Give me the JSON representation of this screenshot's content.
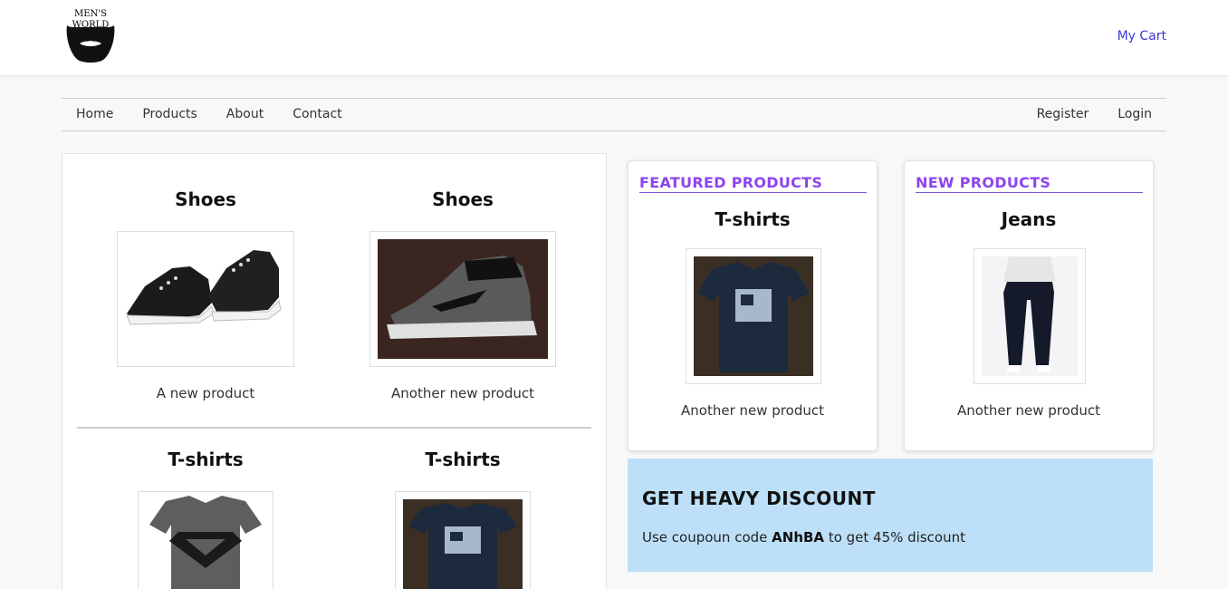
{
  "brand": {
    "logo_line1": "MEN'S",
    "logo_line2": "WORLD",
    "logo_icon": "beard-icon"
  },
  "header": {
    "cart_label": "My Cart",
    "link_color": "#3a3ad6"
  },
  "nav": {
    "left": [
      "Home",
      "Products",
      "About",
      "Contact"
    ],
    "right": [
      "Register",
      "Login"
    ]
  },
  "products": [
    {
      "title": "Shoes",
      "description": "A new product",
      "image": "sneakers-image"
    },
    {
      "title": "Shoes",
      "description": "Another new product",
      "image": "high-top-shoe-image"
    },
    {
      "title": "T-shirts",
      "description": "",
      "image": "superman-batman-tshirt-image"
    },
    {
      "title": "T-shirts",
      "description": "",
      "image": "navy-graphic-tshirt-image"
    }
  ],
  "featured": {
    "heading": "FEATURED PRODUCTS",
    "title": "T-shirts",
    "description": "Another new product",
    "image": "navy-graphic-tshirt-image"
  },
  "new_products": {
    "heading": "NEW PRODUCTS",
    "title": "Jeans",
    "description": "Another new product",
    "image": "dark-jeans-image"
  },
  "discount": {
    "title": "GET HEAVY DISCOUNT",
    "text_before": "Use coupoun code ",
    "code": "ANhBA",
    "text_after": " to get 45% discount",
    "background": "#bde0f8"
  },
  "colors": {
    "heading_accent": "#8e44ef"
  }
}
